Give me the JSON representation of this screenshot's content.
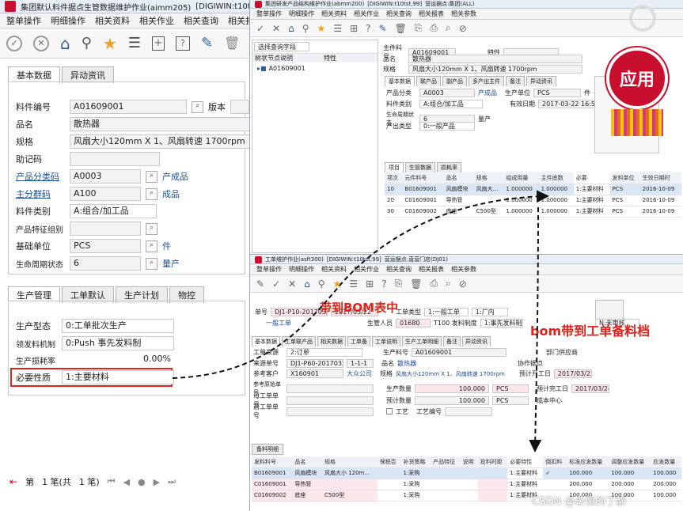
{
  "left": {
    "title": "集团默认料件据点生管数据维护作业(aimm205)",
    "title_tag": "[DIGIWIN:t10t",
    "menu": [
      "整单操作",
      "明细操作",
      "相关资料",
      "相关作业",
      "相关查询",
      "相关报表"
    ],
    "toolbar_icons": [
      "confirm-icon",
      "cancel-icon",
      "home-icon",
      "pin-icon",
      "star-icon",
      "list-icon",
      "add-icon",
      "query-icon",
      "edit-icon",
      "delete-icon"
    ],
    "tabs": [
      "基本数据",
      "异动资讯"
    ],
    "fields": {
      "item_no": {
        "label": "料件编号",
        "value": "A01609001"
      },
      "version_label": "版本",
      "name": {
        "label": "品名",
        "value": "散热器"
      },
      "spec": {
        "label": "规格",
        "value": "风扇大小120mm X 1、风扇转速 1700rpm"
      },
      "mnemonic": {
        "label": "助记码",
        "value": ""
      },
      "category": {
        "label": "产品分类码",
        "value": "A0003",
        "desc": "产成品"
      },
      "group": {
        "label": "主分群码",
        "value": "A100",
        "desc": "成品"
      },
      "item_type": {
        "label": "料件类别",
        "value": "A:组合/加工品"
      },
      "feature_group": {
        "label": "产品特征组别",
        "value": ""
      },
      "base_unit": {
        "label": "基础单位",
        "value": "PCS",
        "desc": "件"
      },
      "life_status": {
        "label": "生命周期状态",
        "value": "6",
        "desc": "量产"
      }
    },
    "tabs2": [
      "生产管理",
      "工单默认",
      "生产计划",
      "物控"
    ],
    "fields2": {
      "prod_type": {
        "label": "生产型态",
        "value": "0:工单批次生产"
      },
      "issue": {
        "label": "领发料机制",
        "value": "0:Push 事先发料制"
      },
      "loss": {
        "label": "生产损耗率",
        "value": "0.00%"
      },
      "nature": {
        "label": "必要性质",
        "value": "1:主要材料"
      }
    },
    "pager": {
      "first": "第",
      "record": "1 笔(共",
      "total": "1 笔)"
    }
  },
  "bom": {
    "title": "集团研发产品结构维护作业(abmm200)",
    "title_tag": "[DIGIWIN:t10tst,99]",
    "title_site": "营运据点:集团(ALL)",
    "menu": [
      "整单操作",
      "明细操作",
      "相关资料",
      "相关作业",
      "相关查询",
      "相关报表",
      "相关参数"
    ],
    "tree_select": "选择查询字段",
    "tree_cols": [
      "树状节点说明",
      "特性"
    ],
    "tree_node": "A01609001",
    "head": {
      "item_label": "主件料号",
      "item": "A01609001",
      "feature_label": "特性",
      "name_label": "品名",
      "name": "散热器",
      "spec_label": "规格",
      "spec": "风扇大小120mm X 1、风扇转速 1700rpm"
    },
    "tabs": [
      "基本数据",
      "联产品",
      "副产品",
      "多产出主件",
      "备注",
      "异动资讯"
    ],
    "fields": {
      "category": {
        "label": "产品分类",
        "value": "A0003",
        "desc": "产成品"
      },
      "item_type": {
        "label": "料件类别",
        "value": "A:组合/加工品"
      },
      "life": {
        "label": "生命周期状态",
        "value": "6",
        "desc": "量产"
      },
      "origin": {
        "label": "产出类型",
        "value": "0:一般产品"
      },
      "unit": {
        "label": "生产单位",
        "value": "PCS",
        "desc": "件"
      },
      "eff_date": {
        "label": "有效日期",
        "value": "2017-03-22 16:51:10"
      }
    },
    "sub_tabs": [
      "项目",
      "生管数据",
      "损耗率"
    ],
    "grid_cols": [
      "项次",
      "元件料号",
      "品名",
      "规格",
      "组成用量",
      "主件底数",
      "必要",
      "发料单位",
      "生效日期时"
    ],
    "grid_rows": [
      [
        "10",
        "B01609001",
        "风扇模块",
        "风扇大...",
        "1.000000",
        "1.000000",
        "1:主要材料",
        "PCS",
        "2016-10-09"
      ],
      [
        "20",
        "C01609001",
        "导热管",
        "",
        "2.000000",
        "1.000000",
        "1:主要材料",
        "PCS",
        "2016-10-09"
      ],
      [
        "30",
        "C01609002",
        "底座",
        "C500型",
        "1.000000",
        "1.000000",
        "1:主要材料",
        "PCS",
        "2016-10-09"
      ]
    ]
  },
  "wo": {
    "title": "工单维护作业(asft300)",
    "title_tag": "[DIGIWIN:t10tst,99]",
    "title_site": "营运据点:直营门店(DJ01)",
    "menu": [
      "整单操作",
      "明细操作",
      "相关资料",
      "相关作业",
      "相关查询",
      "相关报表",
      "相关参数"
    ],
    "head": {
      "no_label": "单号",
      "no": "DJ1-P10-2017032200",
      "date": "2017/03/22",
      "type_label": "工单类型",
      "type": "1:一般工单",
      "site": "1:厂内",
      "normal": "一般工单",
      "person_label": "生管人员",
      "person": "01680",
      "person_desc": "T100 发料制度",
      "issue": "1:事先发料制",
      "status": "N:未审核"
    },
    "tabs": [
      "基本数据",
      "工单联产品",
      "相关数据",
      "工单备",
      "工单说明",
      "生产工单明细",
      "备注",
      "异动资讯"
    ],
    "fields": {
      "source": {
        "label": "工单来源",
        "value": "2:订单"
      },
      "src_no": {
        "label": "来源单号",
        "value": "DJ1-P60-2017032200001",
        "seq": "1-1-1"
      },
      "customer": {
        "label": "参考客户",
        "value": "X160901",
        "desc": "大众公司"
      },
      "ref_no": {
        "label": "参考原始单号",
        "value": ""
      },
      "parent": {
        "label": "母工单单号",
        "value": ""
      },
      "prev": {
        "label": "前工单单号",
        "value": ""
      },
      "item": {
        "label": "生产料号",
        "value": "A01609001"
      },
      "name": {
        "label": "品名",
        "value": "散热器"
      },
      "spec": {
        "label": "规格",
        "value": "风扇大小120mm X 1、风扇转速 1700rpm"
      },
      "qty": {
        "label": "生产数量",
        "value": "100.000",
        "unit": "PCS"
      },
      "plan_qty": {
        "label": "预计数量",
        "value": "100.000",
        "unit": "PCS"
      },
      "process": "工艺",
      "process_no": "工艺编号",
      "dept_label": "部门供应商",
      "coop_label": "协作据点",
      "start_label": "预计开工日",
      "start": "2017/03/22",
      "end_label": "预计完工日",
      "end": "2017/03/24",
      "cost_label": "成本中心"
    },
    "sec": "备料明细",
    "grid_cols": [
      "发料料号",
      "品名",
      "规格",
      "保税否",
      "补货策略",
      "产品特征",
      "说明",
      "投料时距",
      "必要特性",
      "倒扣料",
      "标准应发数量",
      "调整应发数量",
      "应发数量"
    ],
    "grid_rows": [
      [
        "B01609001",
        "风扇模块",
        "风扇大小 120m...",
        "",
        "1:采购",
        "",
        "",
        "",
        "1:主要材料",
        "✓",
        "100.000",
        "100.000",
        "100.000"
      ],
      [
        "C01609001",
        "导热管",
        "",
        "",
        "1:采购",
        "",
        "",
        "",
        "1:主要材料",
        "",
        "200.000",
        "200.000",
        "200.000"
      ],
      [
        "C01609002",
        "底座",
        "C500型",
        "",
        "1:采购",
        "",
        "",
        "",
        "1:主要材料",
        "",
        "100.000",
        "100.000",
        "100.000"
      ]
    ]
  },
  "annotations": {
    "bom_label": "带到BOM表中",
    "wo_label": "bom带到工单备料档",
    "badge": "应用",
    "watermark": "CSDN @永恒的丁静"
  },
  "colors": {
    "accent": "#c8102e",
    "annotation": "#e0221b",
    "link": "#1d4e9a"
  }
}
